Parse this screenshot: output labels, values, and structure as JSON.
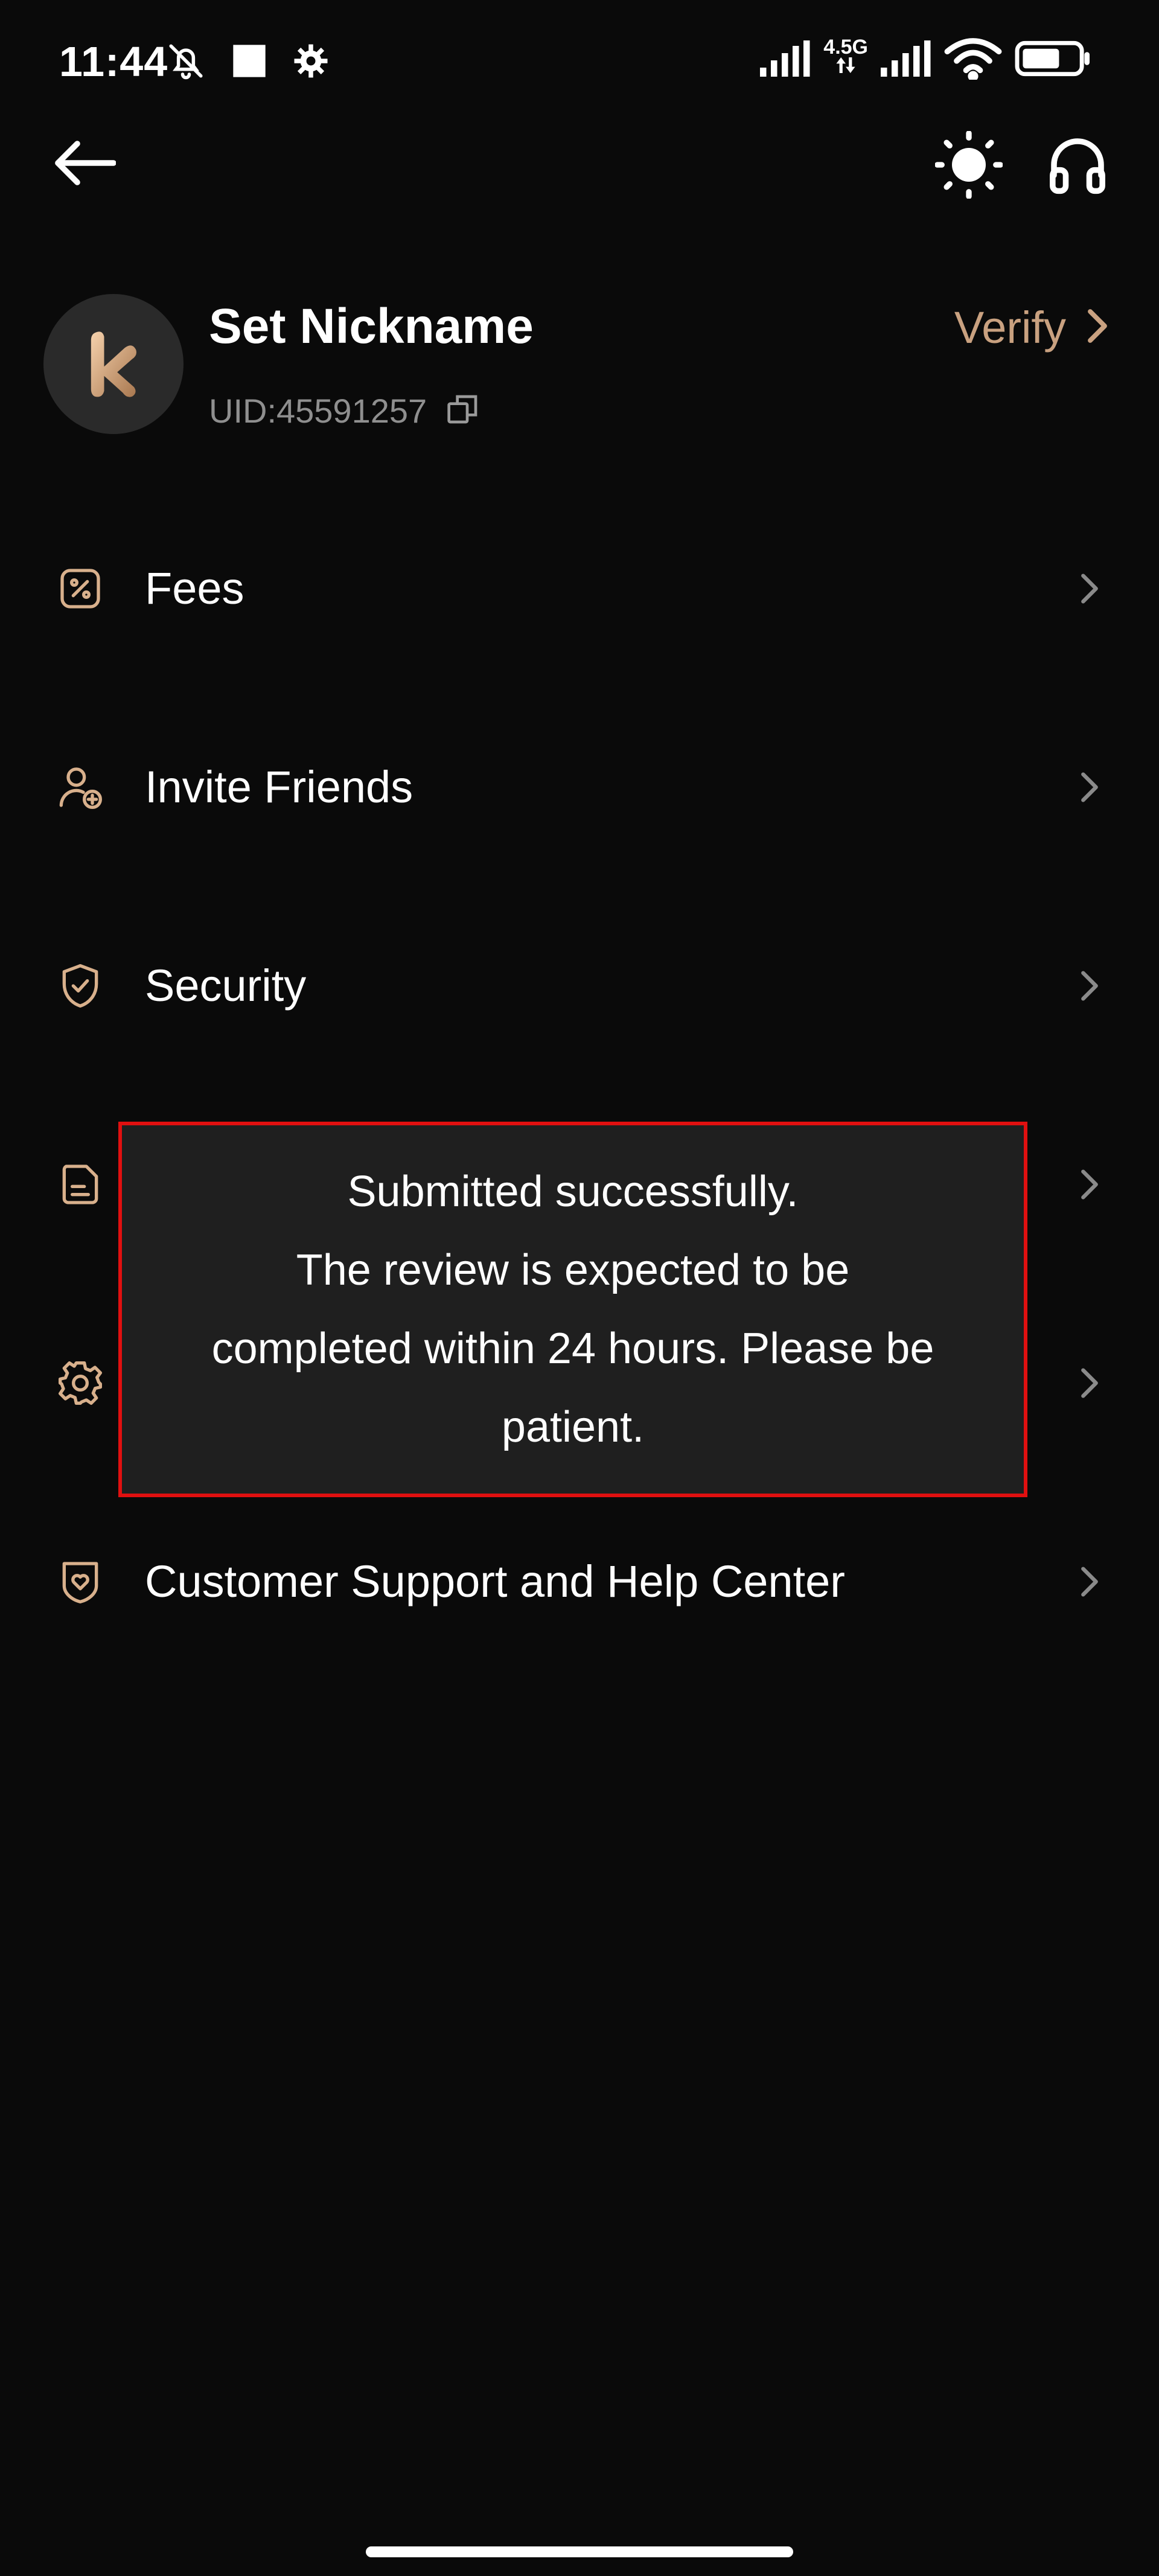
{
  "status_bar": {
    "time": "11:44",
    "network": "4.5G",
    "icons": [
      "bell-muted-icon",
      "square-icon",
      "gear-icon",
      "signal-icon",
      "signal-icon",
      "wifi-icon",
      "battery-icon"
    ]
  },
  "header": {
    "icons": [
      "back-arrow-icon",
      "sun-icon",
      "headphones-icon"
    ]
  },
  "profile": {
    "name": "Set Nickname",
    "uid": "UID:45591257",
    "verify_label": "Verify",
    "avatar_letter": "k"
  },
  "menu": {
    "items": [
      {
        "label": "Fees",
        "icon": "percent-icon"
      },
      {
        "label": "Invite Friends",
        "icon": "user-plus-icon"
      },
      {
        "label": "Security",
        "icon": "shield-check-icon"
      },
      {
        "label": "",
        "icon": "document-icon"
      },
      {
        "label": "",
        "icon": "gear-icon"
      },
      {
        "label": "Customer Support and Help Center",
        "icon": "heart-shield-icon"
      }
    ]
  },
  "toast": {
    "line1": "Submitted successfully.",
    "line2": "The review is expected to be",
    "line3": "completed within 24 hours. Please be",
    "line4": "patient."
  },
  "colors": {
    "background": "#0a0a0a",
    "accent": "#c9a180",
    "toast_background": "#1f1f1f",
    "highlight_border": "#e01010"
  }
}
